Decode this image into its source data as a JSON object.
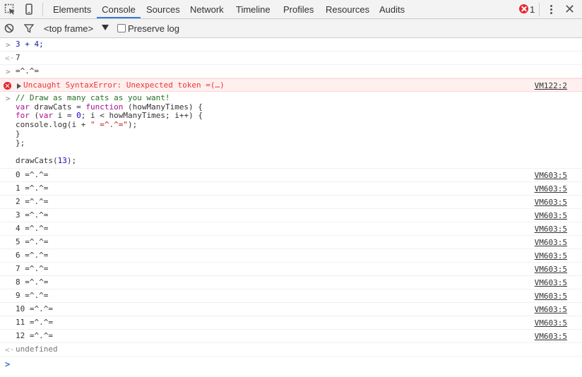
{
  "tabs": [
    "Elements",
    "Console",
    "Sources",
    "Network",
    "Timeline",
    "Profiles",
    "Resources",
    "Audits"
  ],
  "active_tab": "Console",
  "error_count": "1",
  "toolbar": {
    "frame": "<top frame>",
    "preserve_log": "Preserve log"
  },
  "entries": {
    "in1": "3 + 4;",
    "out1": "7",
    "in2": "=^.^=",
    "error_text": "Uncaught SyntaxError: Unexpected token =(…)",
    "error_src": "VM122:2",
    "code_comment": "// Draw as many cats as you want!",
    "code_line2_a": "var",
    "code_line2_b": " drawCats = ",
    "code_line2_c": "function",
    "code_line2_d": " (howManyTimes) {",
    "code_line3_a": "for",
    "code_line3_b": " (",
    "code_line3_c": "var",
    "code_line3_d": " i = ",
    "code_line3_e": "0",
    "code_line3_f": "; i < howManyTimes; i++) {",
    "code_line4_a": "console.log(i + ",
    "code_line4_b": "\" =^.^=\"",
    "code_line4_c": ");",
    "code_line5": "}",
    "code_line6": "};",
    "code_line8_a": "drawCats(",
    "code_line8_b": "13",
    "code_line8_c": ");",
    "result": "undefined"
  },
  "logs": [
    {
      "text": "0 =^.^=",
      "src": "VM603:5"
    },
    {
      "text": "1 =^.^=",
      "src": "VM603:5"
    },
    {
      "text": "2 =^.^=",
      "src": "VM603:5"
    },
    {
      "text": "3 =^.^=",
      "src": "VM603:5"
    },
    {
      "text": "4 =^.^=",
      "src": "VM603:5"
    },
    {
      "text": "5 =^.^=",
      "src": "VM603:5"
    },
    {
      "text": "6 =^.^=",
      "src": "VM603:5"
    },
    {
      "text": "7 =^.^=",
      "src": "VM603:5"
    },
    {
      "text": "8 =^.^=",
      "src": "VM603:5"
    },
    {
      "text": "9 =^.^=",
      "src": "VM603:5"
    },
    {
      "text": "10 =^.^=",
      "src": "VM603:5"
    },
    {
      "text": "11 =^.^=",
      "src": "VM603:5"
    },
    {
      "text": "12 =^.^=",
      "src": "VM603:5"
    }
  ]
}
